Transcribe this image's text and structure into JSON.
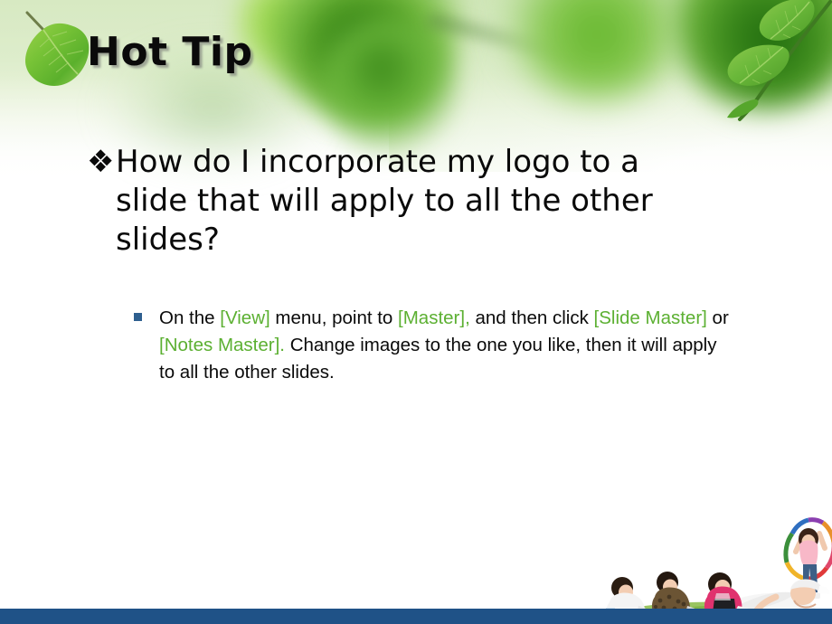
{
  "slide": {
    "title": "Hot Tip",
    "question": {
      "bullet_glyph": "❖",
      "text": "How do I incorporate my logo to a slide that will apply to all the other slides?"
    },
    "answer": {
      "bullet_glyph": "▪",
      "segments": [
        {
          "text": "On the ",
          "highlight": false
        },
        {
          "text": "[View]",
          "highlight": true
        },
        {
          "text": " menu, point to ",
          "highlight": false
        },
        {
          "text": "[Master],",
          "highlight": true
        },
        {
          "text": " and then click ",
          "highlight": false
        },
        {
          "text": "[Slide Master]",
          "highlight": true
        },
        {
          "text": " or ",
          "highlight": false
        },
        {
          "text": "[Notes Master].",
          "highlight": true
        },
        {
          "text": " Change images to the one you like, then it will apply to all the other slides.",
          "highlight": false
        }
      ],
      "plain_text": "On the [View] menu, point to [Master], and then click [Slide Master] or [Notes Master]. Change images to the one you like, then it will apply to all the other slides."
    }
  },
  "decor": {
    "top_left_leaf": "leaf-icon",
    "top_right_branch": "branch-leaves-icon",
    "background_foliage": "blurred-foliage",
    "bottom_right_photo": "family-on-grass-photo",
    "hula_hoop": "rainbow-hoop"
  },
  "colors": {
    "title_text": "#0a0a0a",
    "body_text": "#0a0a0a",
    "highlight_green": "#5cb032",
    "sub_bullet_blue": "#2e5f8f",
    "bottom_bar_blue": "#1f5287",
    "header_green": "#d7e9c2"
  }
}
